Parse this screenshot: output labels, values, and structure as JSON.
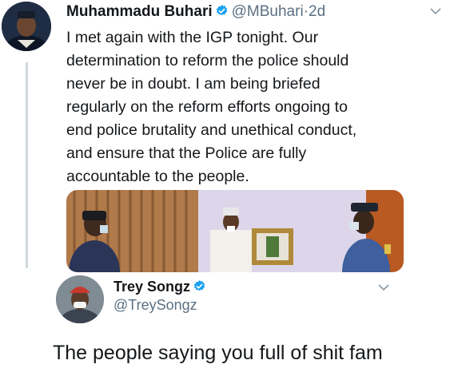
{
  "tweet": {
    "author_name": "Muhammadu Buhari",
    "handle": "@MBuhari",
    "separator": "·",
    "time": "2d",
    "text_lines": [
      "I met again with the IGP tonight. Our",
      "determination to reform the police should",
      "never be in doubt. I am being briefed",
      "regularly on the reform efforts ongoing to",
      "end police brutality and unethical conduct,",
      "and ensure that the Police are fully",
      "accountable to the people."
    ]
  },
  "quoted": {
    "author_name": "Trey Songz",
    "handle": "@TreySongz"
  },
  "caption": "The people saying you full of shit fam",
  "icons": {
    "verified": "verified-badge-icon",
    "menu": "chevron-down-icon"
  },
  "colors": {
    "verified": "#1da1f2",
    "handle": "#5b7083",
    "text": "#14171a",
    "thread_line": "#cfd9de"
  }
}
